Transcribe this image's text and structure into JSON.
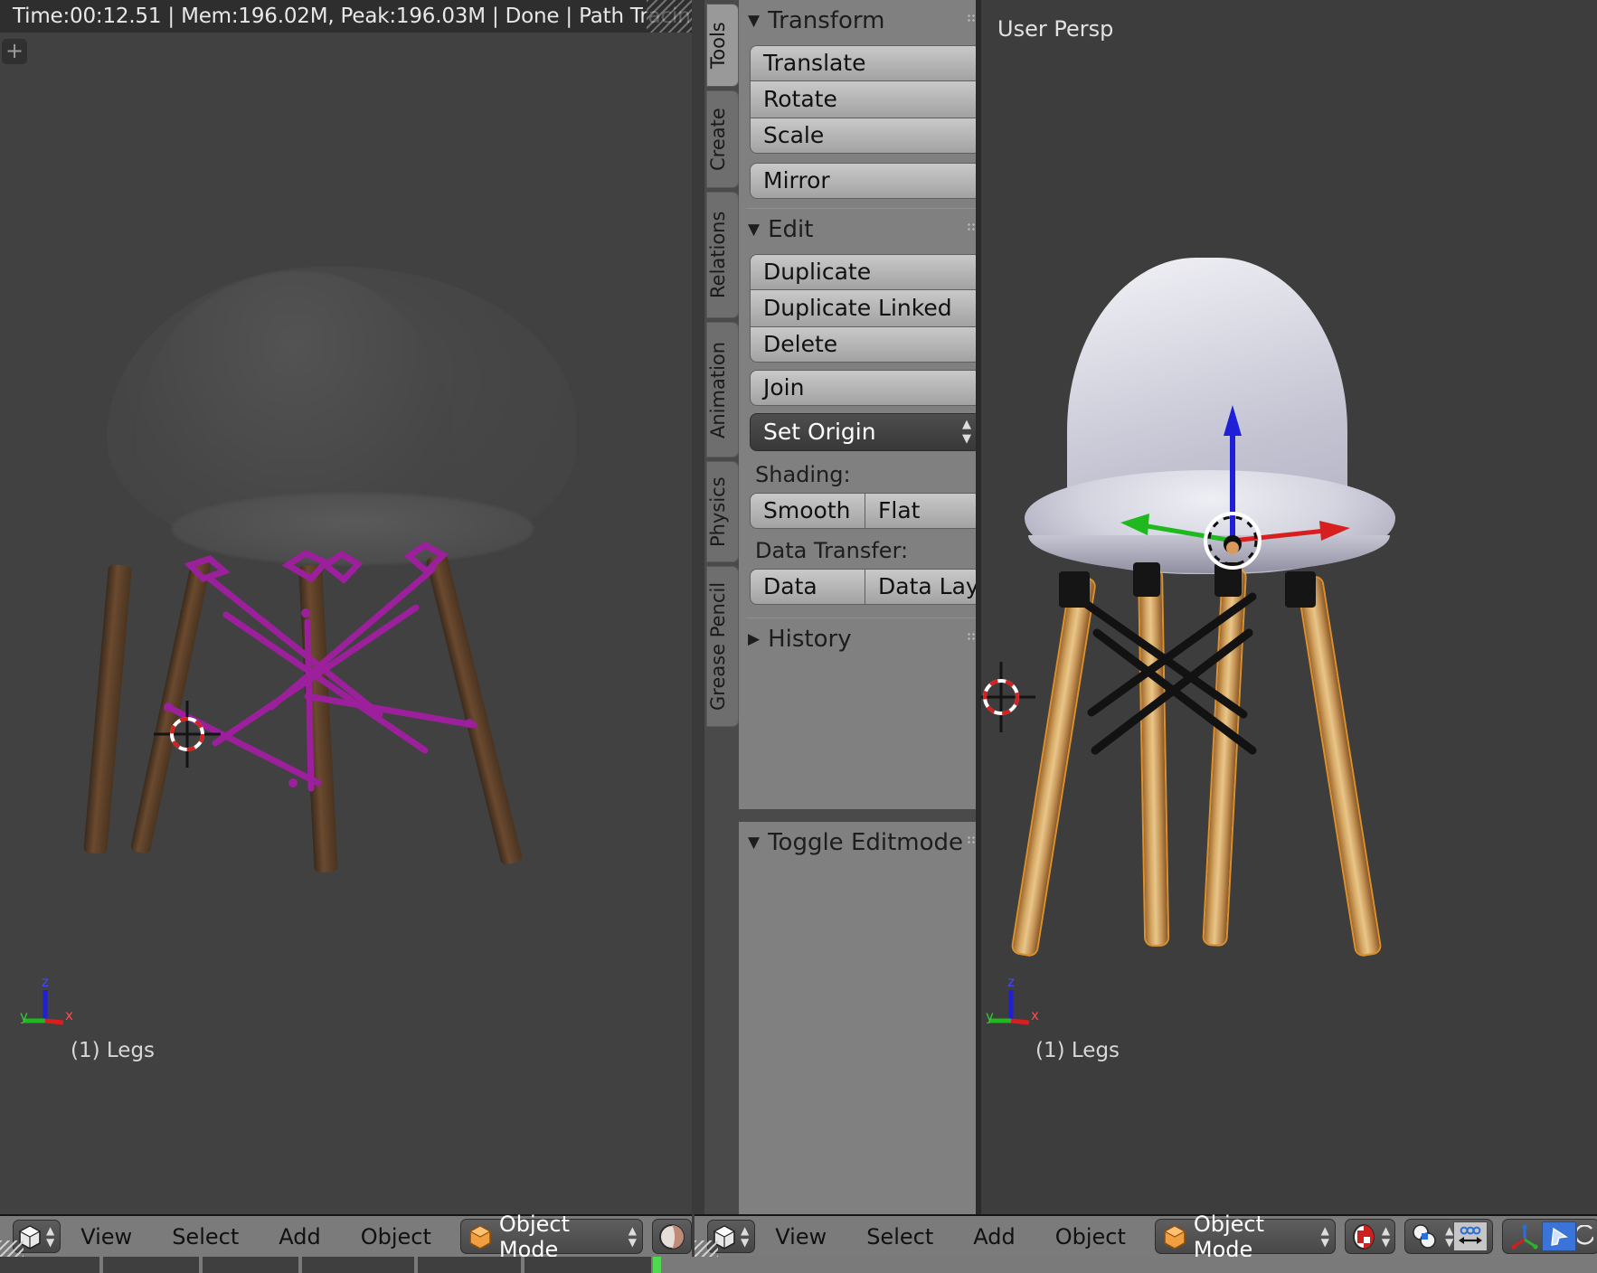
{
  "render_status": {
    "text": "Time:00:12.51 | Mem:196.02M, Peak:196.03M | Done | Path Tracing",
    "time": "00:12.51",
    "mem": "196.02M",
    "peak": "196.03M",
    "state": "Done",
    "engine": "Path Tracing"
  },
  "left_viewport": {
    "plus_label": "+",
    "object_label": "(1) Legs",
    "axis_labels": {
      "z": "z",
      "y": "y",
      "x": "x"
    }
  },
  "right_viewport": {
    "view_label": "User Persp",
    "object_label": "(1) Legs",
    "axis_labels": {
      "z": "z",
      "y": "y",
      "x": "x"
    }
  },
  "toolshelf": {
    "tabs": [
      {
        "label": "Tools",
        "active": true
      },
      {
        "label": "Create",
        "active": false
      },
      {
        "label": "Relations",
        "active": false
      },
      {
        "label": "Animation",
        "active": false
      },
      {
        "label": "Physics",
        "active": false
      },
      {
        "label": "Grease Pencil",
        "active": false
      }
    ],
    "panels": [
      {
        "title": "Transform",
        "open": true,
        "buttons": [
          "Translate",
          "Rotate",
          "Scale",
          "Mirror"
        ]
      },
      {
        "title": "Edit",
        "open": true,
        "buttons": [
          "Duplicate",
          "Duplicate Linked",
          "Delete",
          "Join"
        ],
        "dropdown": "Set Origin",
        "shading_label": "Shading:",
        "shading_options": [
          "Smooth",
          "Flat"
        ],
        "data_transfer_label": "Data Transfer:",
        "data_transfer_options": [
          "Data",
          "Data Lay"
        ]
      },
      {
        "title": "History",
        "open": false
      },
      {
        "title": "Toggle Editmode",
        "open": true
      }
    ]
  },
  "headers": {
    "left": {
      "menus": [
        "View",
        "Select",
        "Add",
        "Object"
      ],
      "mode": "Object Mode"
    },
    "right": {
      "menus": [
        "View",
        "Select",
        "Add",
        "Object"
      ],
      "mode": "Object Mode"
    }
  },
  "colors": {
    "axis_x": "#d81f1f",
    "axis_y": "#1fb81f",
    "axis_z": "#1f1fd8",
    "wireframe_select": "#9c1f9c",
    "outline_select": "#fa9e28",
    "playhead": "#4ed94e",
    "panel_bg": "#808080",
    "viewport_bg": "#3d3d3d",
    "header_bg": "#7b7b7b"
  }
}
